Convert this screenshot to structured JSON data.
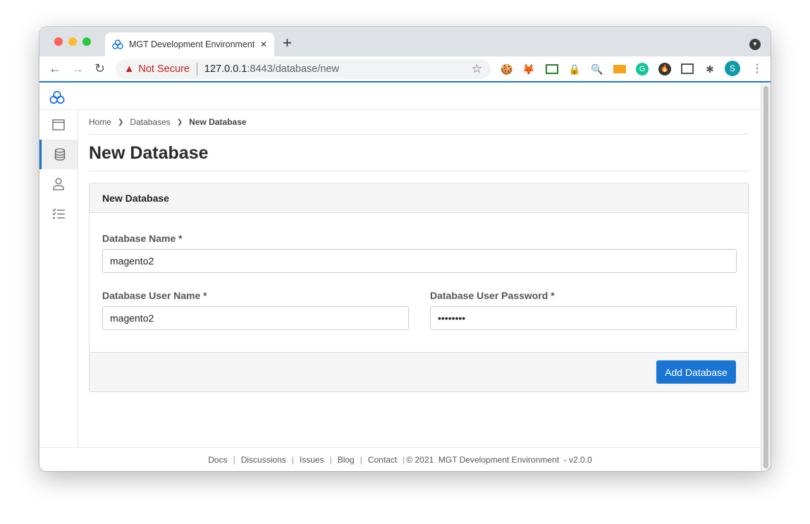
{
  "browser": {
    "tab_title": "MGT Development Environment",
    "new_tab": "+",
    "close": "✕",
    "not_secure": "Not Secure",
    "url_host": "127.0.0.1",
    "url_rest": ":8443/database/new",
    "profile_initial": "S",
    "extensions": [
      "cookie-icon",
      "metamask-fox-icon",
      "screenshot-icon",
      "lock-icon",
      "search-extension-icon",
      "analytics-icon",
      "grammarly-icon",
      "fire-icon",
      "screen-capture-icon",
      "puzzle-icon"
    ]
  },
  "breadcrumb": {
    "home": "Home",
    "databases": "Databases",
    "current": "New Database"
  },
  "page_title": "New Database",
  "card": {
    "title": "New Database",
    "db_name_label": "Database Name *",
    "db_name_value": "magento2",
    "db_user_label": "Database User Name *",
    "db_user_value": "magento2",
    "db_pass_label": "Database User Password *",
    "db_pass_value": "password",
    "submit": "Add Database"
  },
  "footer": {
    "links": [
      "Docs",
      "Discussions",
      "Issues",
      "Blog",
      "Contact"
    ],
    "copyright": "© 2021  MGT Development Environment  - v2.0.0"
  },
  "colors": {
    "accent": "#1a75d2",
    "warning": "#c5221f"
  }
}
